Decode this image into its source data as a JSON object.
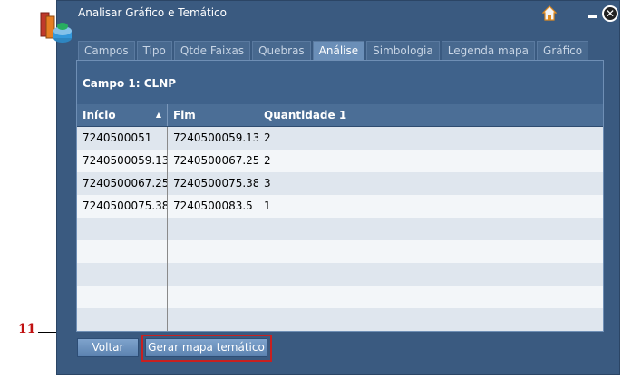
{
  "window": {
    "title": "Analisar Gráfico e Temático"
  },
  "tabs": [
    {
      "label": "Campos",
      "active": false
    },
    {
      "label": "Tipo",
      "active": false
    },
    {
      "label": "Qtde Faixas",
      "active": false
    },
    {
      "label": "Quebras",
      "active": false
    },
    {
      "label": "Análise",
      "active": true
    },
    {
      "label": "Simbologia",
      "active": false
    },
    {
      "label": "Legenda mapa",
      "active": false
    },
    {
      "label": "Gráfico",
      "active": false
    }
  ],
  "panel": {
    "campo_label": "Campo 1: CLNP"
  },
  "grid": {
    "columns": [
      "Início",
      "Fim",
      "Quantidade 1"
    ],
    "sort_indicator": "▲",
    "rows": [
      [
        "7240500051",
        "7240500059.13",
        "2"
      ],
      [
        "7240500059.13",
        "7240500067.25",
        "2"
      ],
      [
        "7240500067.25",
        "7240500075.38",
        "3"
      ],
      [
        "7240500075.38",
        "7240500083.5",
        "1"
      ],
      [
        "",
        "",
        ""
      ],
      [
        "",
        "",
        ""
      ],
      [
        "",
        "",
        ""
      ],
      [
        "",
        "",
        ""
      ],
      [
        "",
        "",
        ""
      ]
    ]
  },
  "buttons": {
    "voltar": "Voltar",
    "gerar": "Gerar mapa temático"
  },
  "callout": {
    "number": "11"
  },
  "icons": {
    "home": "home-icon",
    "minimize": "minimize-icon",
    "close": "close-icon",
    "app": "report-icon"
  },
  "colors": {
    "window": "#3a5a80",
    "highlight": "#c82020"
  }
}
